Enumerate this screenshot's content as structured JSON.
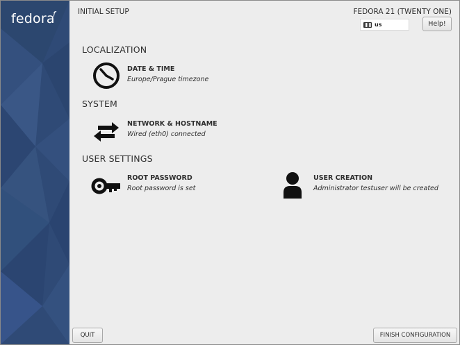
{
  "sidebar": {
    "logo_text": "fedora",
    "logo_mark": "f",
    "background_color": "#2f4a76"
  },
  "header": {
    "setup_title": "INITIAL SETUP",
    "product_title": "FEDORA 21 (TWENTY ONE)",
    "keyboard_layout": "us",
    "keyboard_icon": "keyboard-icon",
    "help_label": "Help!"
  },
  "sections": {
    "localization": "LOCALIZATION",
    "system": "SYSTEM",
    "user_settings": "USER SETTINGS"
  },
  "spokes": {
    "date_time": {
      "title": "DATE & TIME",
      "status": "Europe/Prague timezone",
      "icon": "clock-icon"
    },
    "network": {
      "title": "NETWORK & HOSTNAME",
      "status": "Wired (eth0) connected",
      "icon": "network-arrows-icon"
    },
    "root_password": {
      "title": "ROOT PASSWORD",
      "status": "Root password is set",
      "icon": "key-icon"
    },
    "user_creation": {
      "title": "USER CREATION",
      "status": "Administrator testuser will be created",
      "icon": "user-icon"
    }
  },
  "footer": {
    "quit_label": "QUIT",
    "finish_label": "FINISH CONFIGURATION"
  }
}
